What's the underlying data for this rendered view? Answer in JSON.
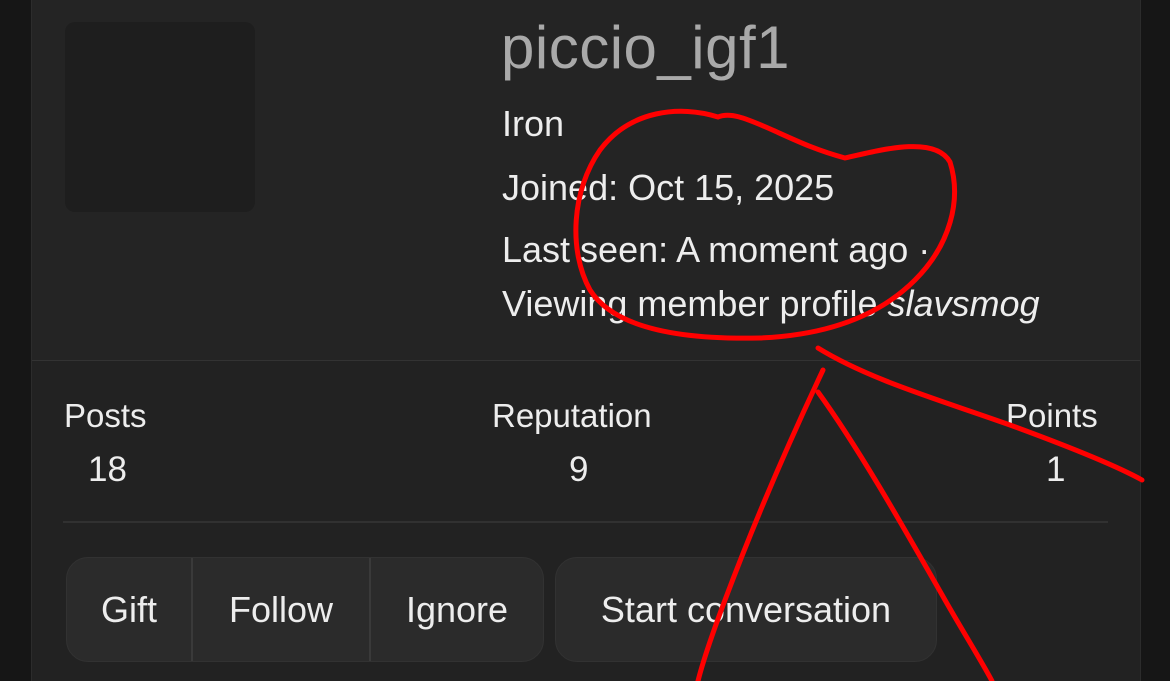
{
  "profile": {
    "username": "piccio_igf1",
    "rank": "Iron",
    "joined": "Joined: Oct 15, 2025",
    "last_seen": "Last seen: A moment ago ·",
    "viewing_prefix": "Viewing member profile ",
    "viewing_target": "slavsmog"
  },
  "stats": [
    {
      "label": "Posts",
      "value": "18"
    },
    {
      "label": "Reputation",
      "value": "9"
    },
    {
      "label": "Points",
      "value": "1"
    }
  ],
  "actions": {
    "gift": "Gift",
    "follow": "Follow",
    "ignore": "Ignore",
    "start_conversation": "Start conversation"
  },
  "annotation": {
    "color": "#ff0000"
  }
}
